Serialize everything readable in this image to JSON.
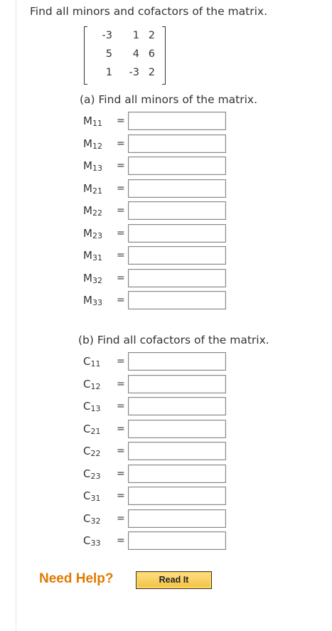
{
  "question": "Find all minors and cofactors of the matrix.",
  "matrix": [
    [
      "-3",
      "1",
      "2"
    ],
    [
      "5",
      "4",
      "6"
    ],
    [
      "1",
      "-3",
      "2"
    ]
  ],
  "part_a": {
    "title": "(a) Find all minors of the matrix.",
    "letter": "M",
    "rows": [
      {
        "sub": "11",
        "value": ""
      },
      {
        "sub": "12",
        "value": ""
      },
      {
        "sub": "13",
        "value": ""
      },
      {
        "sub": "21",
        "value": ""
      },
      {
        "sub": "22",
        "value": ""
      },
      {
        "sub": "23",
        "value": ""
      },
      {
        "sub": "31",
        "value": ""
      },
      {
        "sub": "32",
        "value": ""
      },
      {
        "sub": "33",
        "value": ""
      }
    ]
  },
  "part_b": {
    "title": "(b) Find all cofactors of the matrix.",
    "letter": "C",
    "rows": [
      {
        "sub": "11",
        "value": ""
      },
      {
        "sub": "12",
        "value": ""
      },
      {
        "sub": "13",
        "value": ""
      },
      {
        "sub": "21",
        "value": ""
      },
      {
        "sub": "22",
        "value": ""
      },
      {
        "sub": "23",
        "value": ""
      },
      {
        "sub": "31",
        "value": ""
      },
      {
        "sub": "32",
        "value": ""
      },
      {
        "sub": "33",
        "value": ""
      }
    ]
  },
  "equals": "=",
  "help": {
    "label": "Need Help?",
    "button": "Read It"
  },
  "colors": {
    "help": "#e07b00",
    "button": "#f2c23e"
  }
}
